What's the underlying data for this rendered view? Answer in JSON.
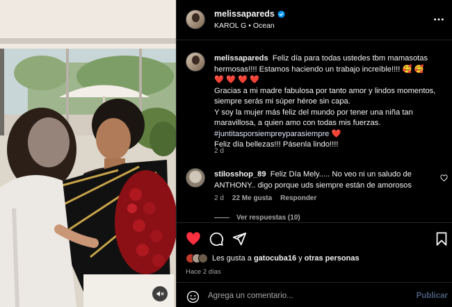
{
  "header": {
    "username": "melissapareds",
    "audio_artist": "KAROL G",
    "audio_separator": "•",
    "audio_track": "Ocean"
  },
  "caption": {
    "username": "melissapareds",
    "line1": "Feliz día para todas ustedes tbm mamasotas hermosas!!!! Estamos haciendo un trabajo increíble!!!! 🥰 🥰",
    "line2": "❤️ ❤️ ❤️ ❤️",
    "line3": "Gracias a mi madre fabulosa por tanto amor y lindos momentos, siempre serás mi súper héroe sin capa.",
    "line4": "Y soy la mujer más feliz del mundo por tener una niña tan maravillosa, a quien amo con todas mis fuerzas.",
    "hashtag": "#juntitasporsiempreyparasiempre",
    "hashtag_emoji": "❤️",
    "line5": "Feliz día bellezas!!! Pásenla lindo!!!!",
    "time": "2 d"
  },
  "comment": {
    "username": "stilosshop_89",
    "text": "Feliz Día Mely..... No veo ni un saludo de ANTHONY.. digo porque uds siempre están de amorosos",
    "time": "2 d",
    "likes": "22 Me gusta",
    "reply": "Responder",
    "view_replies": "Ver respuestas (10)"
  },
  "likes": {
    "prefix": "Les gusta a",
    "user": "gatocuba16",
    "connector": "y",
    "others": "otras personas"
  },
  "post_time": "Hace 2 días",
  "add_comment": {
    "placeholder": "Agrega un comentario...",
    "publish": "Publicar"
  },
  "icons": {
    "like": "heart-filled-icon",
    "comment": "comment-icon",
    "share": "share-icon",
    "save": "bookmark-icon",
    "more": "more-icon",
    "mute": "muted-speaker-icon",
    "emoji": "emoji-icon",
    "verified": "verified-badge-icon"
  },
  "colors": {
    "like_red": "#ff3040",
    "verified_blue": "#0095f6",
    "secondary_text": "#a8a8a8",
    "publish_disabled": "#4a5d7a"
  }
}
